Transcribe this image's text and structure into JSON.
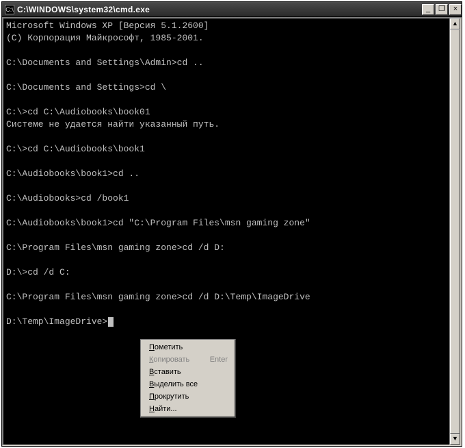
{
  "window": {
    "title": "C:\\WINDOWS\\system32\\cmd.exe",
    "icon_glyph": "C:\\"
  },
  "terminal": {
    "lines": [
      "Microsoft Windows XP [Версия 5.1.2600]",
      "(C) Корпорация Майкрософт, 1985-2001.",
      "",
      "C:\\Documents and Settings\\Admin>cd ..",
      "",
      "C:\\Documents and Settings>cd \\",
      "",
      "C:\\>cd C:\\Audiobooks\\book01",
      "Системе не удается найти указанный путь.",
      "",
      "C:\\>cd C:\\Audiobooks\\book1",
      "",
      "C:\\Audiobooks\\book1>cd ..",
      "",
      "C:\\Audiobooks>cd /book1",
      "",
      "C:\\Audiobooks\\book1>cd \"C:\\Program Files\\msn gaming zone\"",
      "",
      "C:\\Program Files\\msn gaming zone>cd /d D:",
      "",
      "D:\\>cd /d C:",
      "",
      "C:\\Program Files\\msn gaming zone>cd /d D:\\Temp\\ImageDrive",
      "",
      "D:\\Temp\\ImageDrive>"
    ]
  },
  "context_menu": {
    "items": [
      {
        "label": "Пометить",
        "enabled": true,
        "accel": ""
      },
      {
        "label": "Копировать",
        "enabled": false,
        "accel": "Enter"
      },
      {
        "label": "Вставить",
        "enabled": true,
        "accel": ""
      },
      {
        "label": "Выделить все",
        "enabled": true,
        "accel": ""
      },
      {
        "label": "Прокрутить",
        "enabled": true,
        "accel": ""
      },
      {
        "label": "Найти...",
        "enabled": true,
        "accel": ""
      }
    ]
  },
  "controls": {
    "minimize": "_",
    "maximize": "❐",
    "close": "×",
    "scroll_up": "▲",
    "scroll_down": "▼"
  }
}
